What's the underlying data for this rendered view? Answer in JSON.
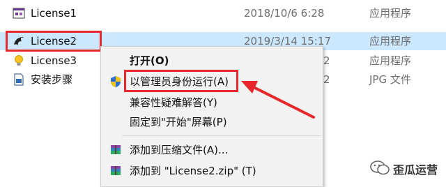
{
  "files": [
    {
      "name": "License1",
      "date": "2018/10/6 6:28",
      "type": "应用程序",
      "icon": "app-window-icon"
    },
    {
      "name": "License2",
      "date": "2019/3/14 15:17",
      "type": "应用程序",
      "icon": "dragon-app-icon"
    },
    {
      "name": "License3",
      "date": "",
      "type": "应用程序",
      "icon": "lightbulb-icon"
    },
    {
      "name": "安装步骤",
      "date": "",
      "type": "JPG 文件",
      "icon": "image-file-icon"
    }
  ],
  "partial_date_digit": "2",
  "context_menu": {
    "items": [
      {
        "label": "打开(O)",
        "icon": ""
      },
      {
        "label": "以管理员身份运行(A)",
        "icon": "uac-shield-icon"
      },
      {
        "label": "兼容性疑难解答(Y)",
        "icon": ""
      },
      {
        "label": "固定到\"开始\"屏幕(P)",
        "icon": ""
      },
      {
        "label": "添加到压缩文件(A)...",
        "icon": "winrar-archive-icon"
      },
      {
        "label": "添加到 \"License2.zip\" (T)",
        "icon": "winrar-archive-icon"
      }
    ]
  },
  "watermark": {
    "text": "歪瓜运营",
    "icon": "wechat-icon"
  },
  "colors": {
    "selection": "#cce8ff",
    "highlight_red": "#e8282c"
  }
}
